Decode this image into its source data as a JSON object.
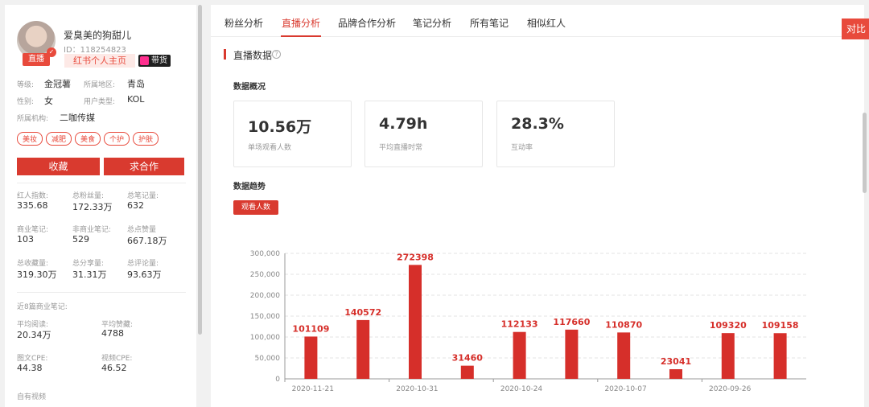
{
  "profile": {
    "name": "爱臭美的狗甜儿",
    "id": "ID：118254823",
    "live_badge": "直播",
    "home_button": "红书个人主页",
    "cargo_button": "带货",
    "level_label": "等级:",
    "level_value": "金冠薯",
    "region_label": "所属地区:",
    "region_value": "青岛",
    "gender_label": "性别:",
    "gender_value": "女",
    "usertype_label": "用户类型:",
    "usertype_value": "KOL",
    "org_label": "所属机构:",
    "org_value": "二咖传媒",
    "tags": [
      "美妆",
      "减肥",
      "美食",
      "个护",
      "护肤"
    ],
    "collect_button": "收藏",
    "cooperate_button": "求合作"
  },
  "stats": [
    {
      "label": "红人指数:",
      "value": "335.68"
    },
    {
      "label": "总粉丝量:",
      "value": "172.33万"
    },
    {
      "label": "总笔记量:",
      "value": "632"
    },
    {
      "label": "商业笔记:",
      "value": "103"
    },
    {
      "label": "非商业笔记:",
      "value": "529"
    },
    {
      "label": "总点赞量",
      "value": "667.18万"
    },
    {
      "label": "总收藏量:",
      "value": "319.30万"
    },
    {
      "label": "总分享量:",
      "value": "31.31万"
    },
    {
      "label": "总评论量:",
      "value": "93.63万"
    }
  ],
  "recent": {
    "title": "近8篇商业笔记:",
    "items": [
      {
        "label": "平均阅读:",
        "value": "20.34万"
      },
      {
        "label": "平均赞藏:",
        "value": "4788"
      },
      {
        "label": "图文CPE:",
        "value": "44.38"
      },
      {
        "label": "视频CPE:",
        "value": "46.52"
      }
    ],
    "more_label": "自有视频"
  },
  "tabs": [
    "粉丝分析",
    "直播分析",
    "品牌合作分析",
    "笔记分析",
    "所有笔记",
    "相似红人"
  ],
  "active_tab": "直播分析",
  "compare_button": "对比",
  "section": {
    "title": "直播数据",
    "help": "?",
    "overview_title": "数据概况",
    "trend_title": "数据趋势",
    "trend_button": "观看人数"
  },
  "metrics": [
    {
      "value": "10.56万",
      "label": "单场观看人数"
    },
    {
      "value": "4.79h",
      "label": "平均直播时常"
    },
    {
      "value": "28.3%",
      "label": "互动率"
    }
  ],
  "colors": {
    "accent": "#d93a2f",
    "bar": "#d62f2a"
  },
  "chart_data": {
    "type": "bar",
    "title": "",
    "xlabel": "",
    "ylabel": "",
    "ylim": [
      0,
      300000
    ],
    "yticks": [
      "0",
      "50,000",
      "100,000",
      "150,000",
      "200,000",
      "250,000",
      "300,000"
    ],
    "x_tick_labels": [
      "2020-11-21",
      "2020-10-31",
      "2020-10-24",
      "2020-10-07",
      "2020-09-26"
    ],
    "values": [
      101109,
      140572,
      272398,
      31460,
      112133,
      117660,
      110870,
      23041,
      109320,
      109158
    ],
    "grid": true
  }
}
